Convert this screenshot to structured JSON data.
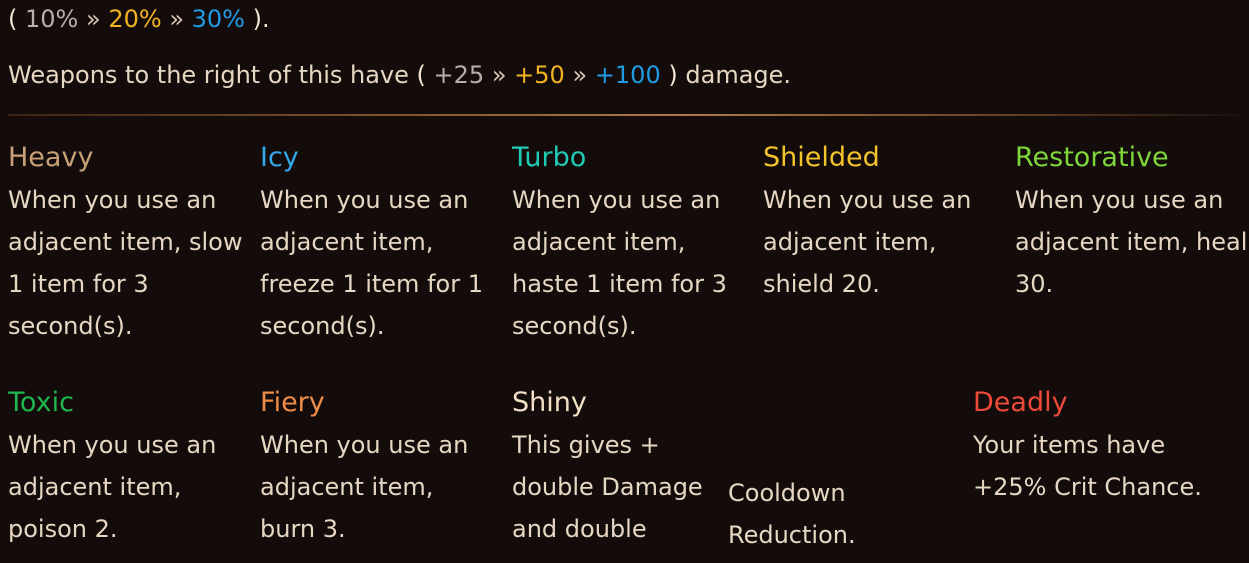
{
  "line1": {
    "open": "(",
    "t1": "10%",
    "sep1": "»",
    "t2": "20%",
    "sep2": "»",
    "t3": "30%",
    "close": ").",
    "colors": {
      "t1": "#b7b0aa",
      "t2": "#f1b323",
      "t3": "#1f9be4"
    }
  },
  "line2": {
    "prefix": "Weapons to the right of this have",
    "open": "(",
    "t1": "+25",
    "sep1": "»",
    "t2": "+50",
    "sep2": "»",
    "t3": "+100",
    "close": ")",
    "suffix": "damage."
  },
  "enchantments": {
    "heavy": {
      "name": "Heavy",
      "color": "#c7a078",
      "desc": "When you use an adjacent item, slow 1 item for 3 second(s)."
    },
    "icy": {
      "name": "Icy",
      "color": "#34a7e6",
      "desc": "When you use an adjacent item, freeze 1 item for 1 second(s)."
    },
    "turbo": {
      "name": "Turbo",
      "color": "#20cbb6",
      "desc": "When you use an adjacent item, haste 1 item for 3 second(s)."
    },
    "shielded": {
      "name": "Shielded",
      "color": "#f2c32a",
      "desc": "When you use an adjacent item, shield 20."
    },
    "restorative": {
      "name": "Restorative",
      "color": "#7fd63a",
      "desc": "When you use an adjacent item, heal 30."
    },
    "toxic": {
      "name": "Toxic",
      "color": "#1fb54e",
      "desc": "When you use an adjacent item, poison 2."
    },
    "fiery": {
      "name": "Fiery",
      "color": "#ef8d48",
      "desc": "When you use an adjacent item, burn 3."
    },
    "shiny": {
      "name": "Shiny",
      "color": "#f1dfc6",
      "desc": "This gives + double Damage and double",
      "desc_extra": "Cooldown Reduction."
    },
    "deadly": {
      "name": "Deadly",
      "color": "#ee4a3a",
      "desc": "Your items have +25% Crit Chance."
    }
  }
}
